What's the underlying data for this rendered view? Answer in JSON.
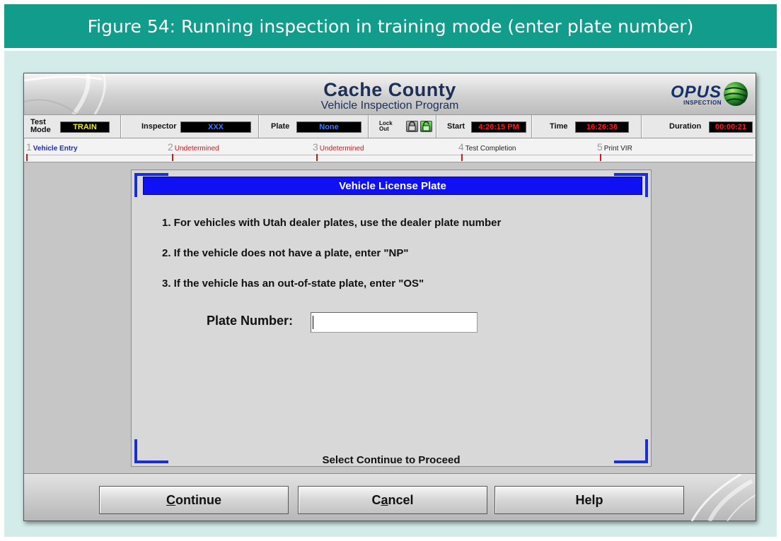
{
  "figure": {
    "caption": "Figure 54: Running inspection in training mode (enter plate number)"
  },
  "app": {
    "title": "Cache County",
    "subtitle": "Vehicle Inspection Program",
    "logo_main": "OPUS",
    "logo_sub": "INSPECTION"
  },
  "status_bar": {
    "test_mode_label_1": "Test",
    "test_mode_label_2": "Mode",
    "test_mode_value": "TRAIN",
    "inspector_label": "Inspector",
    "inspector_value": "XXX",
    "plate_label": "Plate",
    "plate_value": "None",
    "lock_label_1": "Lock",
    "lock_label_2": "Out",
    "start_label": "Start",
    "start_value": "4:26:15 PM",
    "time_label": "Time",
    "time_value": "16:26:36",
    "duration_label": "Duration",
    "duration_value": "00:00:21"
  },
  "steps": [
    {
      "num": "1",
      "label": "Vehicle Entry",
      "color": "#1a2fb5"
    },
    {
      "num": "2",
      "label": "Undetermined",
      "color": "#d01818"
    },
    {
      "num": "3",
      "label": "Undetermined",
      "color": "#d01818"
    },
    {
      "num": "4",
      "label": "Test Completion",
      "color": "#222222"
    },
    {
      "num": "5",
      "label": "Print VIR",
      "color": "#222222"
    }
  ],
  "dialog": {
    "title": "Vehicle License Plate",
    "instructions": [
      "1. For vehicles with Utah dealer plates, use the dealer plate number",
      "2. If the vehicle does not have a plate, enter \"NP\"",
      "3. If the vehicle has an out-of-state plate, enter \"OS\""
    ],
    "plate_label": "Plate Number:",
    "plate_value": "",
    "footer": "Select Continue to Proceed"
  },
  "buttons": {
    "continue_first": "C",
    "continue_rest": "ontinue",
    "cancel_a": "C",
    "cancel_b": "a",
    "cancel_c": "ncel",
    "help": "Help"
  },
  "colors": {
    "figure_header": "#119c8b",
    "figure_body": "#d3ebe9",
    "dialog_title_bg": "#1010f4",
    "corner_blue": "#1a2fd0",
    "readout_yellow": "#f2f200",
    "readout_blue": "#3a7bff",
    "readout_red": "#ff1a1a"
  }
}
